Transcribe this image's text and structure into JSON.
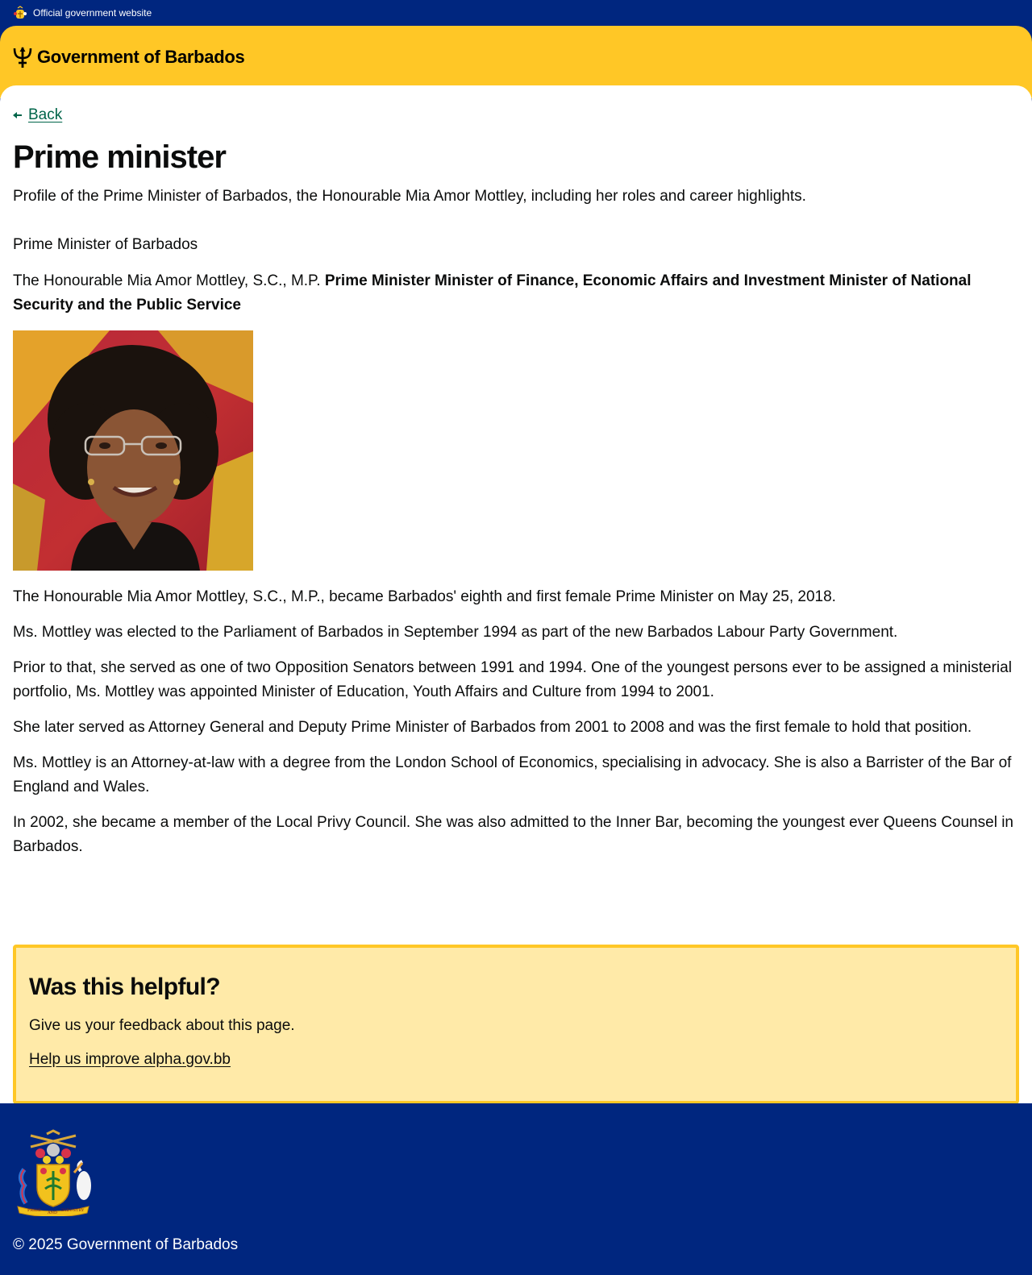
{
  "topbar": {
    "text": "Official government website"
  },
  "header": {
    "brand": "Government of Barbados"
  },
  "nav": {
    "back_label": "Back"
  },
  "page": {
    "title": "Prime minister",
    "lead": "Profile of the Prime Minister of Barbados, the Honourable Mia Amor Mottley, including her roles and career highlights.",
    "role_heading": "Prime Minister of Barbados",
    "name_prefix": "The Honourable Mia Amor Mottley, S.C., M.P. ",
    "roles_bold": "Prime Minister Minister of Finance, Economic Affairs and Investment Minister of National Security and the Public Service",
    "bio": [
      "The Honourable Mia Amor Mottley, S.C., M.P., became Barbados' eighth and first female Prime Minister on May 25, 2018.",
      "Ms. Mottley was elected to the Parliament of Barbados in September 1994 as part of the new Barbados Labour Party Government.",
      "Prior to that, she served as one of two Opposition Senators between 1991 and 1994. One of the youngest persons ever to be assigned a ministerial portfolio, Ms. Mottley was appointed Minister of Education, Youth Affairs and Culture from 1994 to 2001.",
      "She later served as Attorney General and Deputy Prime Minister of Barbados from 2001 to 2008 and was the first female to hold that position.",
      "Ms. Mottley is an Attorney-at-law with a degree from the London School of Economics, specialising in advocacy. She is also a Barrister of the Bar of England and Wales.",
      "In 2002, she became a member of the Local Privy Council. She was also admitted to the Inner Bar, becoming the youngest ever Queens Counsel in Barbados."
    ]
  },
  "feedback": {
    "heading": "Was this helpful?",
    "body": "Give us your feedback about this page.",
    "link": "Help us improve alpha.gov.bb"
  },
  "footer": {
    "copyright": "© 2025 Government of Barbados",
    "coat_motto": [
      "PRIDE",
      "AND",
      "INDUSTRY"
    ]
  },
  "colors": {
    "blue": "#00267f",
    "gold": "#ffc726",
    "pale_gold": "#ffeaa8",
    "link_green": "#00654a"
  }
}
